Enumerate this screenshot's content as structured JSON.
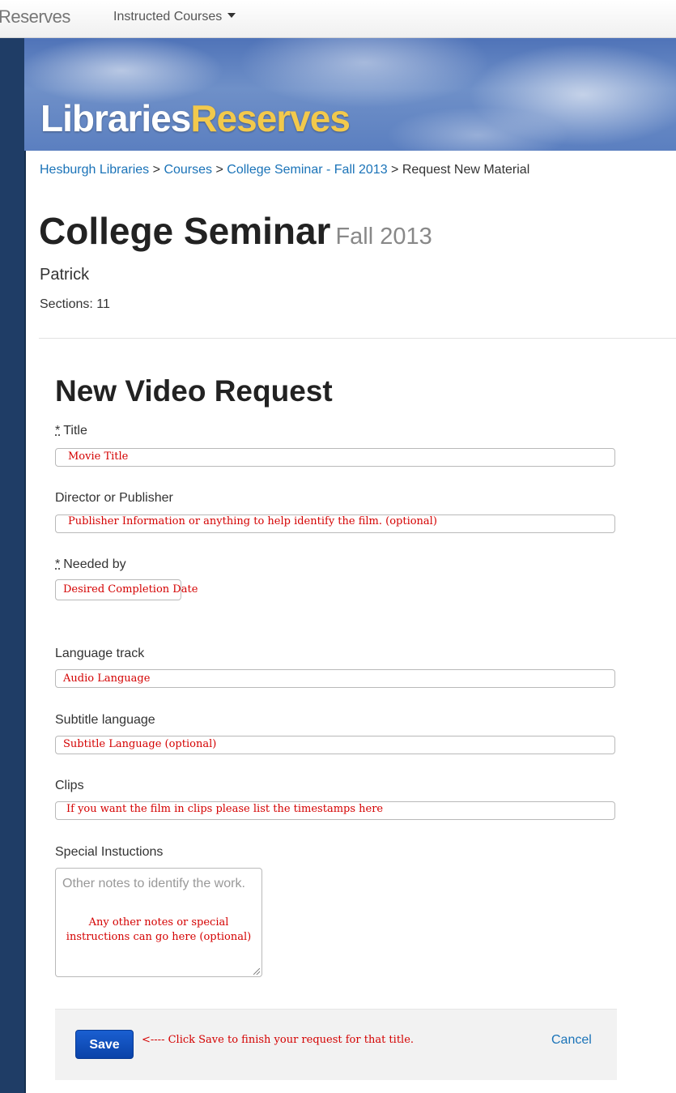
{
  "navbar": {
    "brand": "Reserves",
    "dropdown_label": "Instructed Courses"
  },
  "banner": {
    "part1": "Libraries",
    "part2": "Reserves",
    "colors": {
      "part1": "#ffffff",
      "part2": "#f2c94c",
      "sky": "#5b7fc0"
    }
  },
  "breadcrumb": {
    "items": [
      "Hesburgh Libraries",
      "Courses",
      "College Seminar - Fall 2013"
    ],
    "current": "Request New Material",
    "separator": ">"
  },
  "course": {
    "title": "College Seminar",
    "term": "Fall 2013",
    "instructor": "Patrick",
    "sections": "Sections: 11"
  },
  "form": {
    "heading": "New Video Request",
    "required_marker": "*",
    "title_label": "Title",
    "title_hint": "Movie Title",
    "director_label": "Director or Publisher",
    "director_hint": "Publisher Information or anything to help identify the film. (optional)",
    "needed_label": "Needed by",
    "needed_hint": "Desired Completion Date",
    "language_label": "Language track",
    "language_hint": "Audio Language",
    "subtitle_label": "Subtitle language",
    "subtitle_hint": "Subtitle Language (optional)",
    "clips_label": "Clips",
    "clips_hint": "If you want the film in clips please list the timestamps here",
    "special_label": "Special Instuctions",
    "special_placeholder": "Other notes to identify the work.",
    "special_hint": "Any other notes or special instructions can go here (optional)"
  },
  "actions": {
    "save_label": "Save",
    "save_hint": "<---- Click Save to finish your request for that title.",
    "cancel_label": "Cancel"
  },
  "colors": {
    "accent": "#1a73b8",
    "annotation": "#d40000",
    "save_button": "#0a42a8",
    "rail": "#1f3d66"
  }
}
